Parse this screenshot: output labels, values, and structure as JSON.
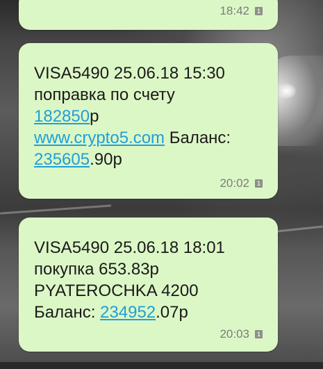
{
  "messages": [
    {
      "time": "18:42",
      "sim": "1"
    },
    {
      "lines": {
        "l1": "VISA5490 25.06.18 15:30",
        "l2": "поправка по счету",
        "amount_link": "182850",
        "amount_suffix": "р",
        "site_link": "www.crypto5.com",
        "balance_label": " Баланс:",
        "balance_link": "235605",
        "balance_suffix": ".90р"
      },
      "time": "20:02",
      "sim": "1"
    },
    {
      "lines": {
        "l1": "VISA5490 25.06.18 18:01",
        "l2": "покупка 653.83р",
        "l3": "PYATEROCHKA 4200",
        "balance_label": "Баланс: ",
        "balance_link": "234952",
        "balance_suffix": ".07р"
      },
      "time": "20:03",
      "sim": "1"
    }
  ],
  "colors": {
    "bubble": "#dcf7c6",
    "link": "#1f9fd8",
    "timestamp": "#7c7c7c"
  }
}
